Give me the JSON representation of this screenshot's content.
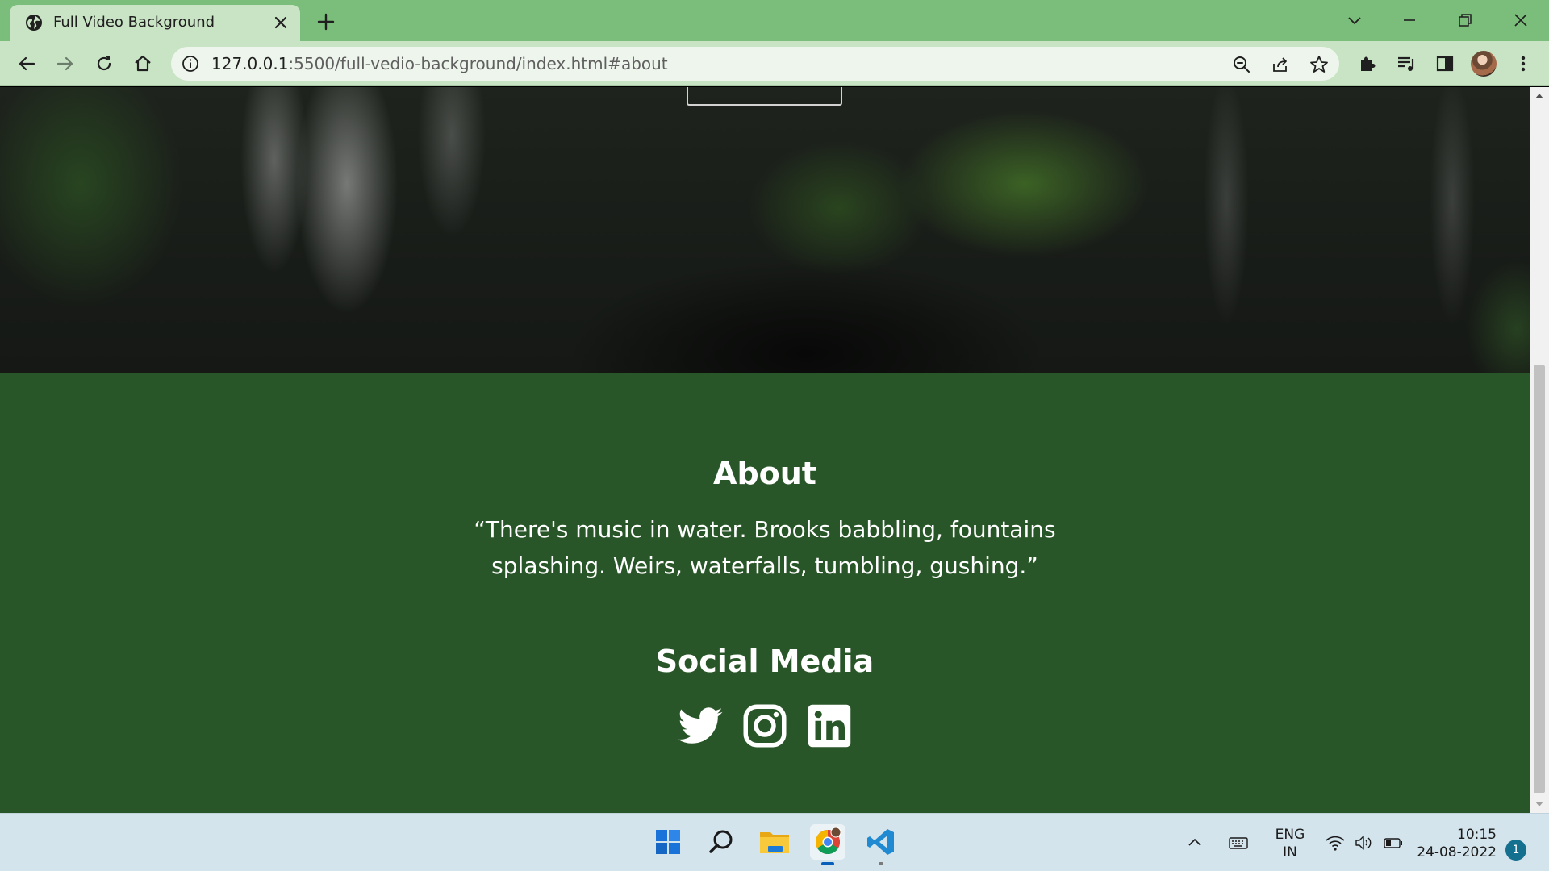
{
  "browser": {
    "tab_title": "Full Video Background",
    "url_host": "127.0.0.1",
    "url_rest": ":5500/full-vedio-background/index.html#about"
  },
  "about": {
    "title": "About",
    "quote": "“There's music in water. Brooks babbling, fountains splashing. Weirs, waterfalls, tumbling, gushing.”"
  },
  "social": {
    "title": "Social Media",
    "icons": [
      "twitter-icon",
      "instagram-icon",
      "linkedin-icon"
    ]
  },
  "taskbar": {
    "apps": [
      "windows-start",
      "search",
      "file-explorer",
      "chrome",
      "vscode"
    ],
    "lang_line1": "ENG",
    "lang_line2": "IN",
    "time": "10:15",
    "date": "24-08-2022",
    "notification_count": "1"
  },
  "colors": {
    "tab_strip": "#7bbd7a",
    "toolbar": "#c9e4c5",
    "about_bg": "#295628",
    "taskbar": "#d3e4ec"
  }
}
